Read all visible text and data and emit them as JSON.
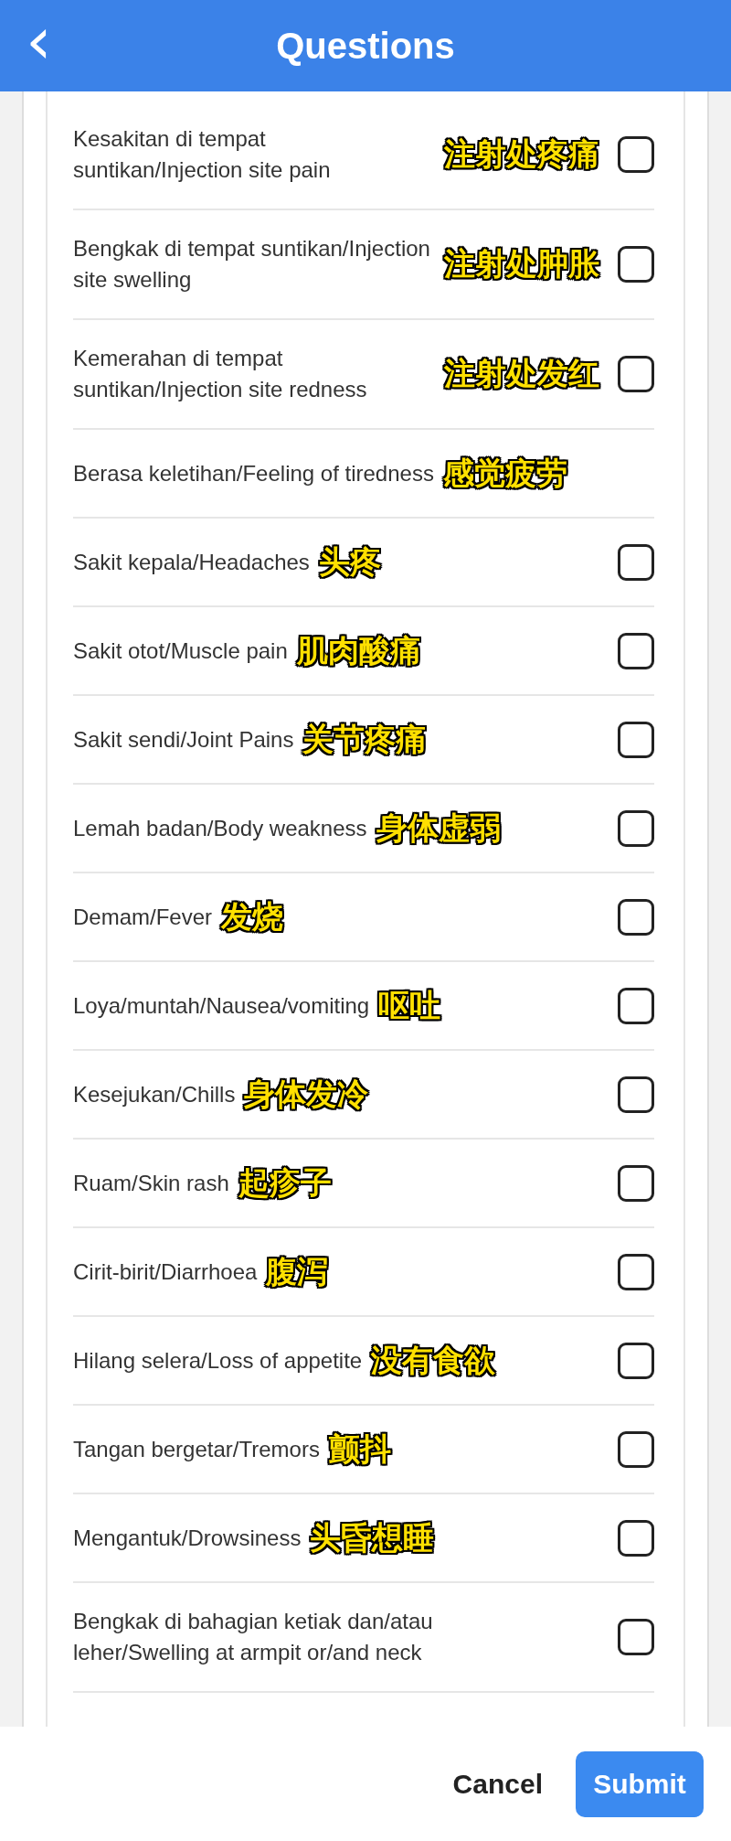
{
  "header": {
    "back_icon": "‹",
    "title": "Questions"
  },
  "questions": [
    {
      "label": "Kesakitan di tempat suntikan/Injection site pain",
      "annotation": "注射处疼痛",
      "checked": false
    },
    {
      "label": "Bengkak di tempat suntikan/Injection site swelling",
      "annotation": "注射处肿胀",
      "checked": false
    },
    {
      "label": "Kemerahan di tempat suntikan/Injection site redness",
      "annotation": "注射处发红",
      "checked": false
    },
    {
      "label": "Berasa keletihan/Feeling of tiredness",
      "annotation": "感觉疲劳"
    },
    {
      "label": "Sakit kepala/Headaches",
      "annotation": "头疼",
      "checked": false
    },
    {
      "label": "Sakit otot/Muscle pain",
      "annotation": "肌肉酸痛",
      "checked": false
    },
    {
      "label": "Sakit sendi/Joint Pains",
      "annotation": "关节疼痛",
      "checked": false
    },
    {
      "label": "Lemah badan/Body weakness",
      "annotation": "身体虚弱",
      "checked": false
    },
    {
      "label": "Demam/Fever",
      "annotation": "发烧",
      "checked": false
    },
    {
      "label": "Loya/muntah/Nausea/vomiting",
      "annotation": "呕吐",
      "checked": false
    },
    {
      "label": "Kesejukan/Chills",
      "annotation": "身体发冷",
      "checked": false
    },
    {
      "label": "Ruam/Skin rash",
      "annotation": "起疹子",
      "checked": false
    },
    {
      "label": "Cirit-birit/Diarrhoea",
      "annotation": "腹泻",
      "checked": false
    },
    {
      "label": "Hilang selera/Loss of appetite",
      "annotation": "没有食欲",
      "checked": false
    },
    {
      "label": "Tangan bergetar/Tremors",
      "annotation": "颤抖",
      "checked": false
    },
    {
      "label": "Mengantuk/Drowsiness",
      "annotation": "头昏想睡",
      "checked": false
    },
    {
      "label": "Bengkak di bahagian ketiak dan/atau leher/Swelling at armpit or/and neck",
      "checked": false
    }
  ],
  "footer": {
    "cancel": "Cancel",
    "submit": "Submit"
  }
}
